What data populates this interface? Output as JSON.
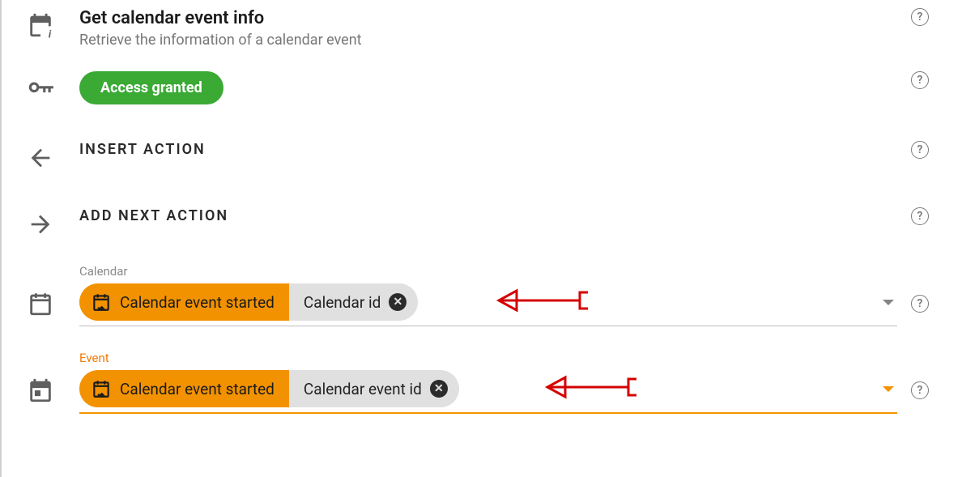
{
  "header": {
    "title": "Get calendar event info",
    "subtitle": "Retrieve the information of a calendar event"
  },
  "access": {
    "badge": "Access granted"
  },
  "sections": {
    "insert": "INSERT ACTION",
    "addNext": "ADD NEXT ACTION"
  },
  "fields": {
    "calendar": {
      "label": "Calendar",
      "source": "Calendar event started",
      "value": "Calendar id"
    },
    "event": {
      "label": "Event",
      "source": "Calendar event started",
      "value": "Calendar event id"
    }
  }
}
